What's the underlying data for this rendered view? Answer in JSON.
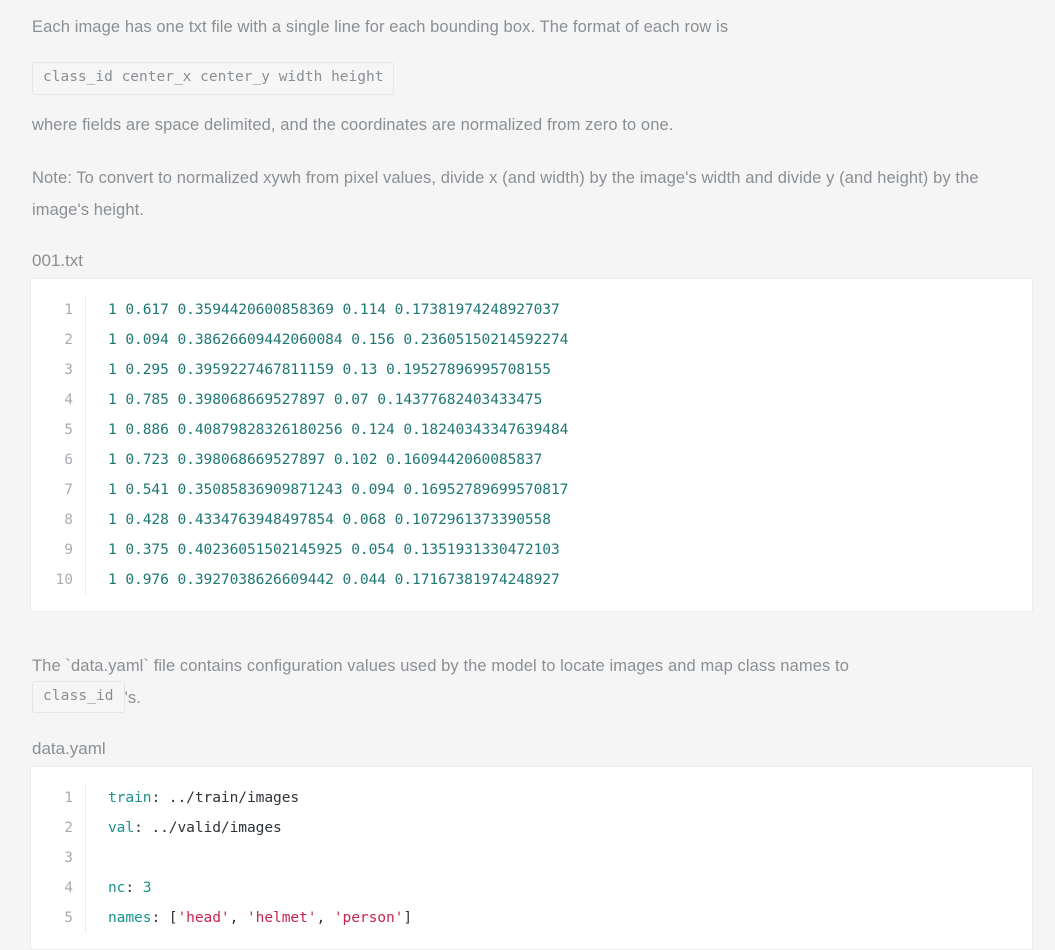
{
  "document": {
    "paragraphs": {
      "intro": "Each image has one txt file with a single line for each bounding box. The format of each row is",
      "format_chip": "class_id center_x center_y width height",
      "delimited_note": "where fields are space delimited, and the coordinates are normalized from zero to one.",
      "convert_note": "Note: To convert to normalized xywh from pixel values, divide x (and width) by the image's width and divide y (and height) by the image's height.",
      "yaml_intro_before": "The `data.yaml` file contains configuration values used by the model to locate images and map class names to",
      "yaml_intro_chip": "class_id",
      "yaml_intro_after": "'s."
    },
    "labels_file": {
      "title": "001.txt",
      "line_numbers": [
        "1",
        "2",
        "3",
        "4",
        "5",
        "6",
        "7",
        "8",
        "9",
        "10"
      ],
      "lines": [
        "1 0.617 0.3594420600858369 0.114 0.17381974248927037",
        "1 0.094 0.38626609442060084 0.156 0.23605150214592274",
        "1 0.295 0.3959227467811159 0.13 0.19527896995708155",
        "1 0.785 0.398068669527897 0.07 0.14377682403433475",
        "1 0.886 0.40879828326180256 0.124 0.18240343347639484",
        "1 0.723 0.398068669527897 0.102 0.1609442060085837",
        "1 0.541 0.35085836909871243 0.094 0.16952789699570817",
        "1 0.428 0.4334763948497854 0.068 0.1072961373390558",
        "1 0.375 0.40236051502145925 0.054 0.1351931330472103",
        "1 0.976 0.3927038626609442 0.044 0.17167381974248927"
      ]
    },
    "config_file": {
      "title": "data.yaml",
      "line_numbers": [
        "1",
        "2",
        "3",
        "4",
        "5"
      ],
      "lines": [
        {
          "key": "train",
          "punc": ":",
          "value": " ../train/images"
        },
        {
          "key": "val",
          "punc": ":",
          "value": " ../valid/images"
        },
        {
          "key": "",
          "punc": "",
          "value": ""
        },
        {
          "key": "nc",
          "punc": ":",
          "number": " 3"
        },
        {
          "key": "names",
          "punc": ":",
          "list_open": " [",
          "items": [
            "'head'",
            "'helmet'",
            "'person'"
          ],
          "separator": ", ",
          "list_close": "]"
        }
      ]
    },
    "colors": {
      "page_background": "#f5f5f5",
      "code_background": "#ffffff",
      "body_text": "#8a8f94",
      "code_text": "#1d7874",
      "yaml_key": "#18928c",
      "yaml_string": "#c7254e",
      "line_number": "#a7adb3",
      "border": "#ececec"
    }
  }
}
